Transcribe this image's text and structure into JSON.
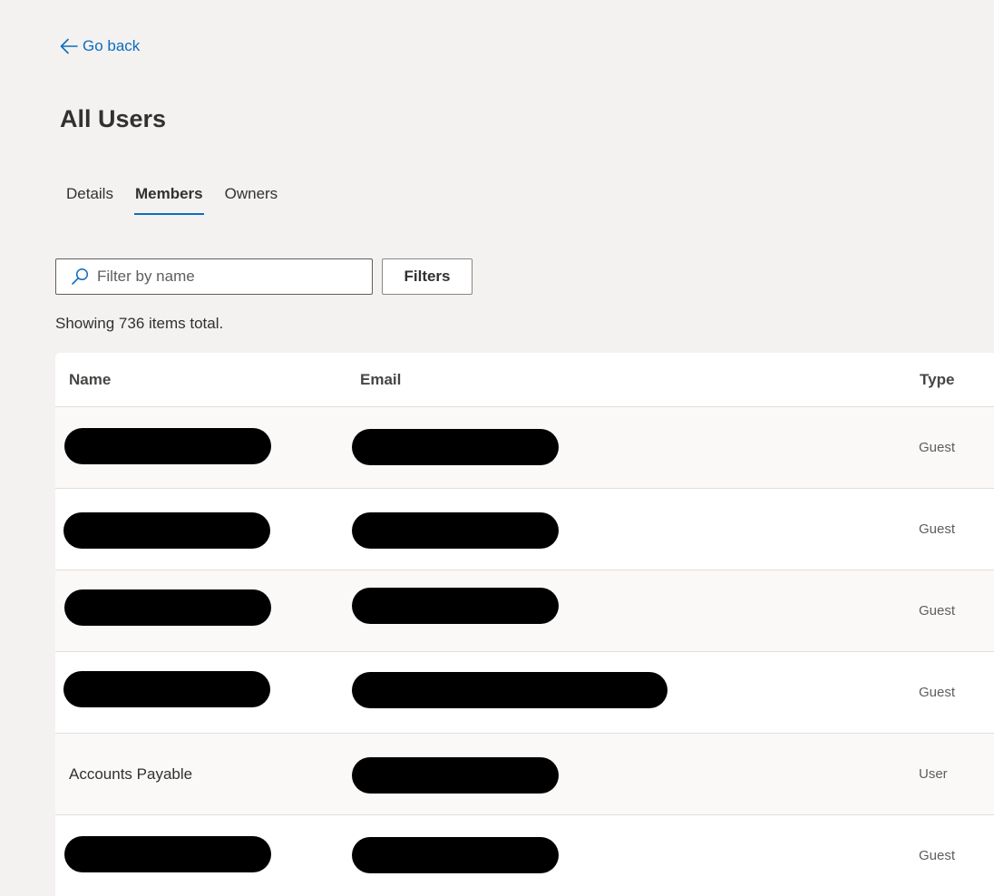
{
  "nav": {
    "back_label": "Go back"
  },
  "page": {
    "title": "All Users"
  },
  "tabs": [
    {
      "label": "Details"
    },
    {
      "label": "Members"
    },
    {
      "label": "Owners"
    }
  ],
  "active_tab": "Members",
  "search": {
    "placeholder": "Filter by name",
    "value": ""
  },
  "toolbar": {
    "filters_label": "Filters"
  },
  "results": {
    "count_text": "Showing 736 items total."
  },
  "table": {
    "columns": [
      "Name",
      "Email",
      "Type"
    ],
    "rows": [
      {
        "name": "[redacted]",
        "email": "[redacted]",
        "type": "Guest"
      },
      {
        "name": "[redacted]",
        "email": "[redacted]",
        "type": "Guest"
      },
      {
        "name": "[redacted]",
        "email": "[redacted]",
        "type": "Guest"
      },
      {
        "name": "[redacted]",
        "email": "[redacted]",
        "type": "Guest"
      },
      {
        "name": "Accounts Payable",
        "email": "[redacted]",
        "type": "User"
      },
      {
        "name": "[redacted]",
        "email": "[redacted]",
        "type": "Guest"
      }
    ]
  },
  "colors": {
    "accent": "#0f6cbd",
    "page_background": "#f3f2f1",
    "text": "#323130"
  },
  "icons": {
    "back": "arrow-left-icon",
    "search": "search-icon"
  }
}
